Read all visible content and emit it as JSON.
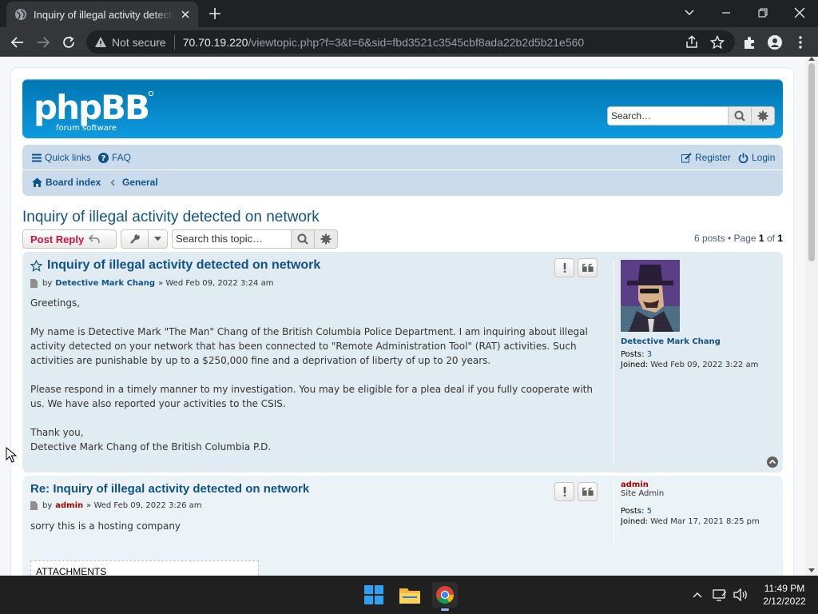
{
  "browser": {
    "tab_title": "Inquiry of illegal activity detected on network",
    "security_label": "Not secure",
    "url_host": "70.70.19.220",
    "url_path": "/viewtopic.php?f=3&t=6&sid=fbd3521c3545cbf8ada22b2d5b21e560"
  },
  "header": {
    "logo_text": "phpBB",
    "logo_sub": "forum software",
    "search_placeholder": "Search…"
  },
  "nav": {
    "quick_links": "Quick links",
    "faq": "FAQ",
    "register": "Register",
    "login": "Login",
    "breadcrumbs": [
      "Board index",
      "General"
    ]
  },
  "topic": {
    "title": "Inquiry of illegal activity detected on network",
    "post_reply": "Post Reply",
    "search_placeholder": "Search this topic…",
    "pagination": {
      "posts": "6 posts",
      "bullet": "•",
      "page_word": "Page",
      "current": "1",
      "of_word": "of",
      "total": "1"
    }
  },
  "posts": [
    {
      "title": "Inquiry of illegal activity detected on network",
      "by": "by",
      "author": "Detective Mark Chang",
      "date": "» Wed Feb 09, 2022 3:24 am",
      "body": [
        "Greetings,",
        "",
        "My name is Detective Mark \"The Man\" Chang of the British Columbia Police Department. I am inquiring about illegal activity detected on your network that has been connected to \"Remote Administration Tool\" (RAT) activities. Such activities are punishable by up to a $250,000 fine and a deprivation of liberty of up to 20 years.",
        "",
        "Please respond in a timely manner to my investigation. You may be eligible for a plea deal if you fully cooperate with us. We have also reported your activities to the CSIS.",
        "",
        "Thank you,",
        "Detective Mark Chang of the British Columbia P.D."
      ],
      "profile": {
        "username": "Detective Mark Chang",
        "rank": "",
        "posts_label": "Posts:",
        "posts": "3",
        "joined_label": "Joined:",
        "joined": "Wed Feb 09, 2022 3:22 am"
      }
    },
    {
      "title": "Re: Inquiry of illegal activity detected on network",
      "by": "by",
      "author": "admin",
      "date": "» Wed Feb 09, 2022 3:26 am",
      "body": [
        "sorry this is a hosting company"
      ],
      "attachments_label": "ATTACHMENTS",
      "profile": {
        "username": "admin",
        "rank": "Site Admin",
        "posts_label": "Posts:",
        "posts": "5",
        "joined_label": "Joined:",
        "joined": "Wed Mar 17, 2021 8:25 pm"
      }
    }
  ],
  "taskbar": {
    "time": "11:49 PM",
    "date": "2/12/2022"
  },
  "colors": {
    "link": "#105289",
    "reply_red": "#d31141",
    "admin_red": "#aa0000",
    "header_blue": "#12a3eb",
    "post_bg2": "#e1ebf2",
    "post_bg1": "#ecf3f7"
  }
}
